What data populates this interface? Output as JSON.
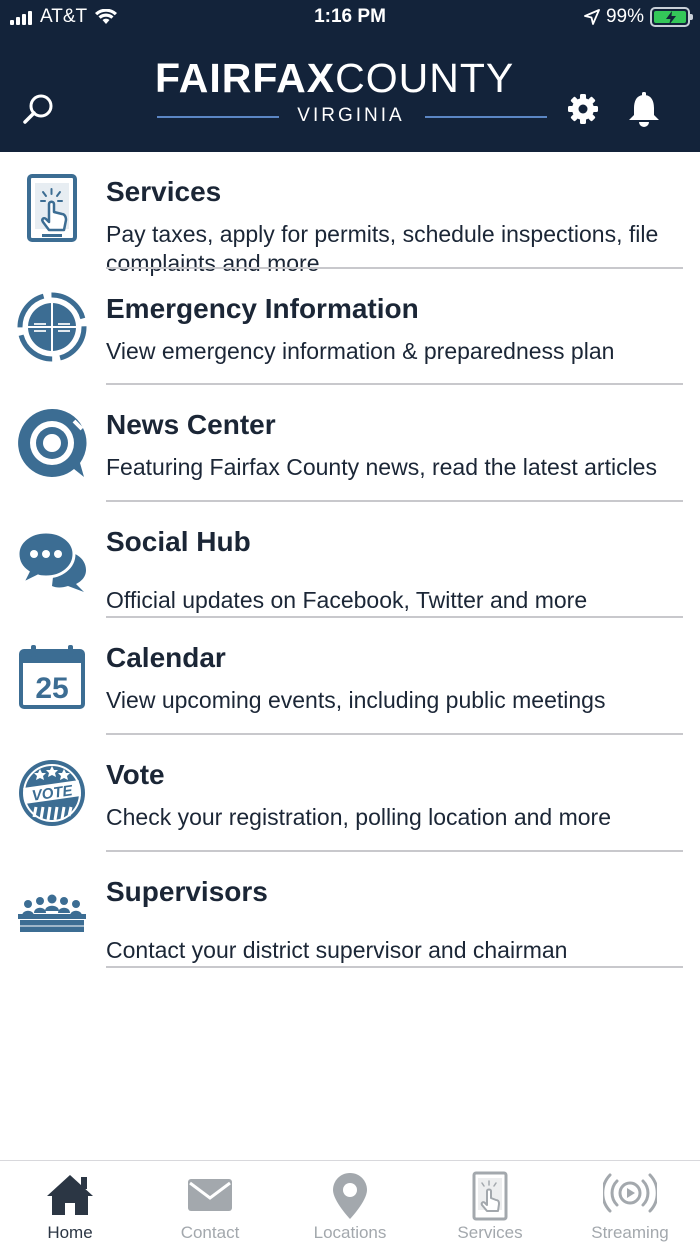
{
  "status_bar": {
    "carrier": "AT&T",
    "time": "1:16 PM",
    "battery": "99%",
    "battery_level": 0.99
  },
  "header": {
    "logo_bold": "FAIRFAX",
    "logo_light": "COUNTY",
    "logo_sub": "VIRGINIA",
    "search_icon": "search-icon",
    "settings_icon": "gear-icon",
    "notifications_icon": "bell-icon"
  },
  "menu": {
    "items": [
      {
        "title": "Services",
        "description": "Pay taxes, apply for permits, schedule inspections, file complaints and more",
        "icon": "tablet-tap-icon"
      },
      {
        "title": "Emergency Information",
        "description": "View emergency information & preparedness plan",
        "icon": "emergency-cycle-icon"
      },
      {
        "title": "News Center",
        "description": "Featuring Fairfax County news, read the latest articles",
        "icon": "news-target-icon"
      },
      {
        "title": "Social Hub",
        "description": "Official updates on Facebook, Twitter and more",
        "icon": "chat-bubbles-icon"
      },
      {
        "title": "Calendar",
        "description": "View upcoming events, including public meetings",
        "icon": "calendar-icon",
        "calendar_day": "25"
      },
      {
        "title": "Vote",
        "description": "Check your registration, polling location and more",
        "icon": "vote-badge-icon",
        "badge_text": "VOTE"
      },
      {
        "title": "Supervisors",
        "description": "Contact your district supervisor and chairman",
        "icon": "board-members-icon"
      }
    ]
  },
  "tabbar": {
    "tabs": [
      {
        "label": "Home",
        "icon": "home-icon",
        "active": true
      },
      {
        "label": "Contact",
        "icon": "envelope-icon",
        "active": false
      },
      {
        "label": "Locations",
        "icon": "map-pin-icon",
        "active": false
      },
      {
        "label": "Services",
        "icon": "tablet-tap-icon",
        "active": false
      },
      {
        "label": "Streaming",
        "icon": "broadcast-play-icon",
        "active": false
      }
    ]
  },
  "colors": {
    "header_bg": "#13233a",
    "icon_blue": "#3c6d93",
    "text_dark": "#1b2636",
    "tab_active": "#2b3644",
    "tab_inactive": "#a3a8ad"
  }
}
